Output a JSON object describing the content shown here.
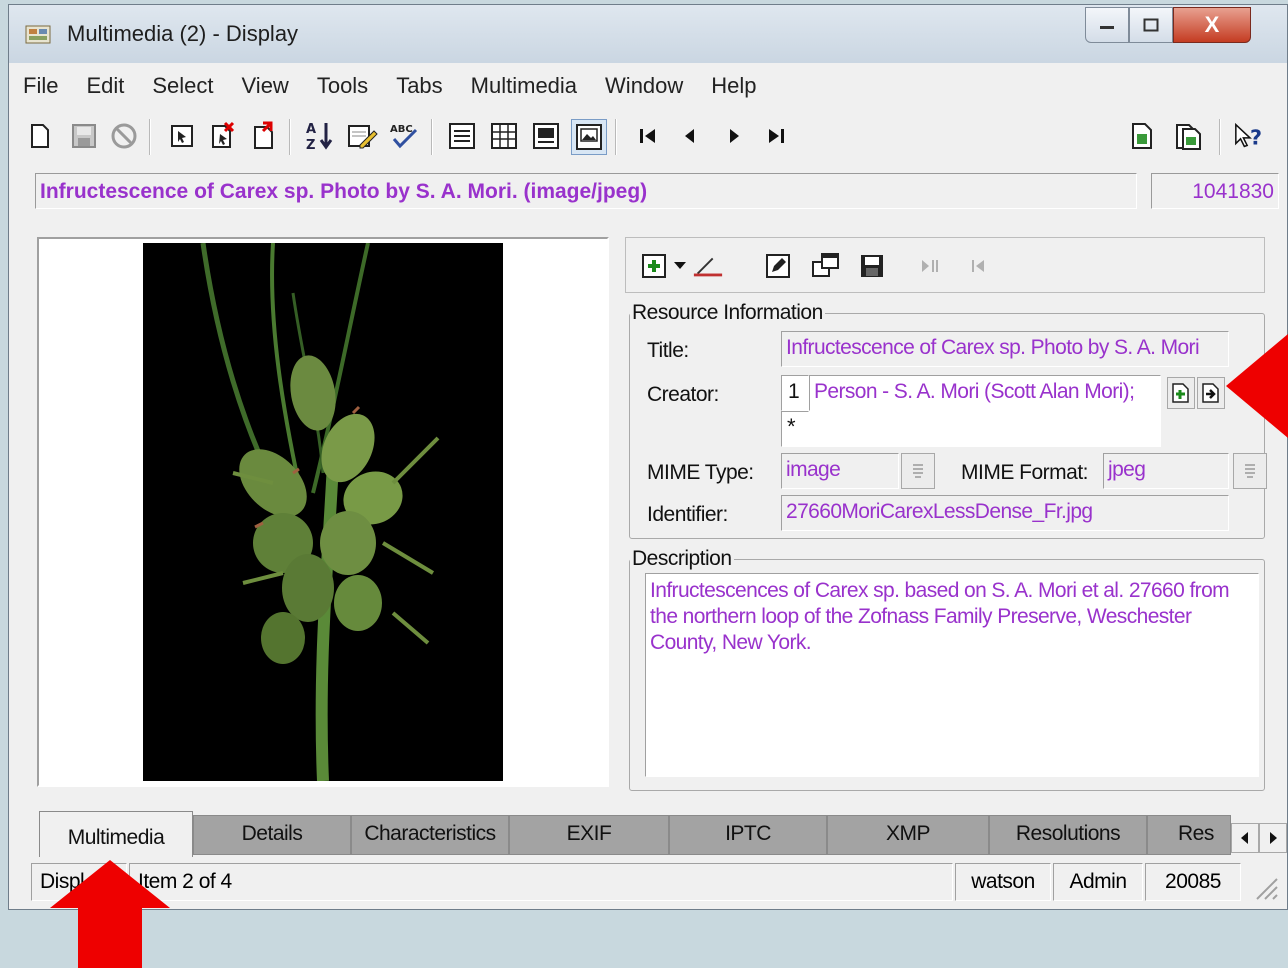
{
  "window": {
    "title": "Multimedia (2) - Display",
    "close_glyph": "X"
  },
  "menu": [
    "File",
    "Edit",
    "Select",
    "View",
    "Tools",
    "Tabs",
    "Multimedia",
    "Window",
    "Help"
  ],
  "record": {
    "summary": "Infructescence of Carex sp. Photo by S. A. Mori. (image/jpeg)",
    "irn": "1041830"
  },
  "resource": {
    "legend": "Resource Information",
    "title_label": "Title:",
    "title_value": "Infructescence of Carex sp. Photo by S. A. Mori",
    "creator_label": "Creator:",
    "creator_row1_num": "1",
    "creator_row1_value": "Person - S. A. Mori (Scott Alan Mori);",
    "creator_row2_marker": "*",
    "mime_type_label": "MIME Type:",
    "mime_type_value": "image",
    "mime_format_label": "MIME Format:",
    "mime_format_value": "jpeg",
    "identifier_label": "Identifier:",
    "identifier_value": "27660MoriCarexLessDense_Fr.jpg"
  },
  "description": {
    "legend": "Description",
    "text": "Infructescences of Carex sp. based on S. A. Mori et al. 27660 from the northern loop of the Zofnass Family Preserve, Weschester County, New York."
  },
  "tabs": [
    "Multimedia",
    "Details",
    "Characteristics",
    "EXIF",
    "IPTC",
    "XMP",
    "Resolutions",
    "Res"
  ],
  "active_tab": "Multimedia",
  "status": {
    "mode": "Displ",
    "item": "Item 2 of 4",
    "user": "watson",
    "group": "Admin",
    "port": "20085"
  },
  "colors": {
    "record_text": "#9932cc",
    "annotation_arrow": "#ee0000"
  },
  "icons": {
    "toolbar": [
      "new-record-icon",
      "save-icon",
      "cancel-icon",
      "select-record-icon",
      "delete-record-icon",
      "duplicate-record-icon",
      "sort-icon",
      "edit-note-icon",
      "spellcheck-icon",
      "details-view-icon",
      "list-view-icon",
      "page-view-icon",
      "image-view-icon",
      "first-record-icon",
      "previous-record-icon",
      "next-record-icon",
      "last-record-icon",
      "report-icon",
      "attach-icon",
      "help-icon"
    ]
  }
}
